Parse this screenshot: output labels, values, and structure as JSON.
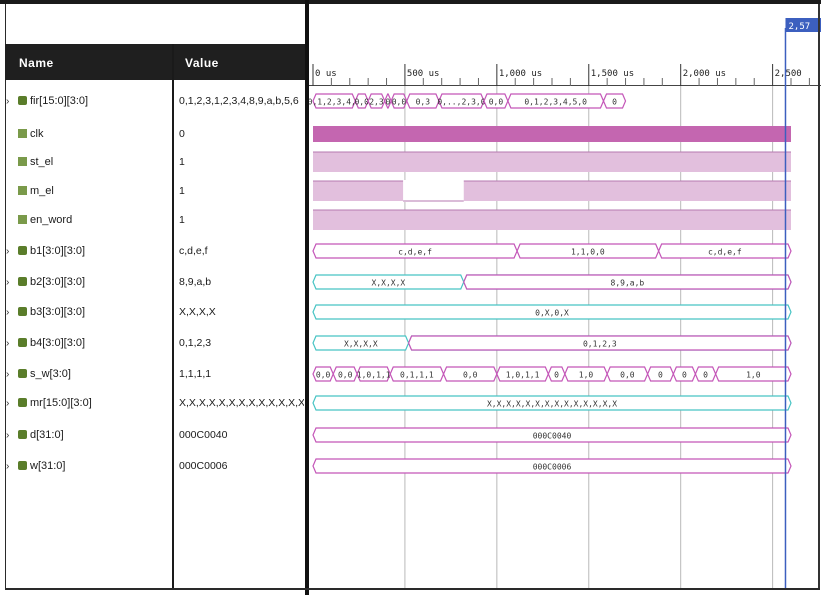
{
  "columns": {
    "name": "Name",
    "value": "Value"
  },
  "cursor_label": "2,57",
  "timeline": {
    "ticks": [
      {
        "label": "0 us",
        "t": 0
      },
      {
        "label": "500 us",
        "t": 500
      },
      {
        "label": "1,000 us",
        "t": 1000
      },
      {
        "label": "1,500 us",
        "t": 1500
      },
      {
        "label": "2,000 us",
        "t": 2000
      },
      {
        "label": "2,500",
        "t": 2500
      }
    ],
    "cursor_time": 2570
  },
  "signals": [
    {
      "name": "fir[15:0][3:0]",
      "value": "0,1,2,3,1,2,3,4,8,9,a,b,5,6",
      "kind": "bus",
      "expandable": true
    },
    {
      "name": "clk",
      "value": "0",
      "kind": "clock",
      "expandable": false
    },
    {
      "name": "st_el",
      "value": "1",
      "kind": "bit",
      "expandable": false
    },
    {
      "name": "m_el",
      "value": "1",
      "kind": "bit",
      "expandable": false
    },
    {
      "name": "en_word",
      "value": "1",
      "kind": "bit",
      "expandable": false
    },
    {
      "name": "b1[3:0][3:0]",
      "value": "c,d,e,f",
      "kind": "bus",
      "expandable": true
    },
    {
      "name": "b2[3:0][3:0]",
      "value": "8,9,a,b",
      "kind": "bus",
      "expandable": true
    },
    {
      "name": "b3[3:0][3:0]",
      "value": "X,X,X,X",
      "kind": "bus",
      "expandable": true
    },
    {
      "name": "b4[3:0][3:0]",
      "value": "0,1,2,3",
      "kind": "bus",
      "expandable": true
    },
    {
      "name": "s_w[3:0]",
      "value": "1,1,1,1",
      "kind": "bus",
      "expandable": true
    },
    {
      "name": "mr[15:0][3:0]",
      "value": "X,X,X,X,X,X,X,X,X,X,X,X,X,X",
      "kind": "bus",
      "expandable": true
    },
    {
      "name": "d[31:0]",
      "value": "000C0040",
      "kind": "bus",
      "expandable": true
    },
    {
      "name": "w[31:0]",
      "value": "000C0006",
      "kind": "bus",
      "expandable": true
    }
  ],
  "wave_labels": {
    "fir": [
      "0,1,2,3,4,5",
      "0,0",
      "2,3",
      "0",
      "0,0",
      "0,3",
      "0,..,2,3,0",
      "0,0",
      "0,1,2,3,4,5,0",
      "0"
    ],
    "b1": [
      "c,d,e,f",
      "1,1,0,0",
      "c,d,e,f"
    ],
    "b2": [
      "X,X,X,X",
      "8,9,a,b"
    ],
    "b3": [
      "0,X,0,X"
    ],
    "b4": [
      "X,X,X,X",
      "0,1,2,3"
    ],
    "s_w": [
      "0,0",
      "0,0",
      "1,0,1,1",
      "0,1,1,1",
      "0,0",
      "1,0,1,1",
      "0",
      "1,0",
      "0,0",
      "0",
      "0",
      "0",
      "1,0"
    ],
    "mr": [
      "X,X,X,X,X,X,X,X,X,X,X,X,X,X"
    ],
    "d": [
      "000C0040"
    ],
    "w": [
      "000C0006"
    ]
  },
  "colors": {
    "clock_fill": "#c466b0",
    "bit_fill": "#e2bfdd",
    "bus_pink": "#c456b8",
    "bus_cyan": "#48c4c4",
    "cursor": "#3c5fbf",
    "header_bg": "#1f1f1f"
  }
}
